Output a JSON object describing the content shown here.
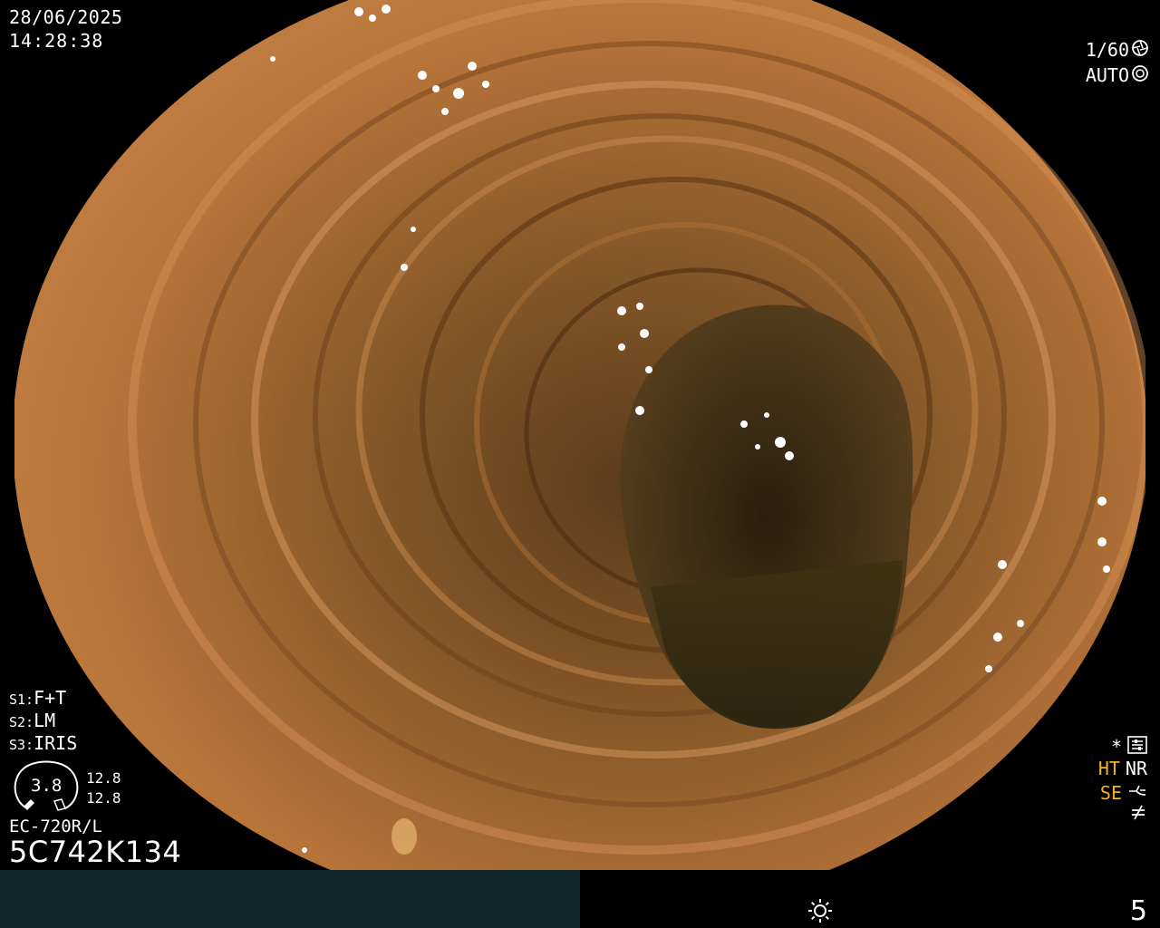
{
  "datetime": {
    "date": "28/06/2025",
    "time": "14:28:38"
  },
  "camera": {
    "shutter": "1/60",
    "shutter_icon": "aperture-icon",
    "iris_mode": "AUTO",
    "iris_icon": "auto-iris-icon"
  },
  "scope_switches": [
    {
      "key": "S1:",
      "value": "F+T"
    },
    {
      "key": "S2:",
      "value": "LM"
    },
    {
      "key": "S3:",
      "value": "IRIS"
    }
  ],
  "gauge": {
    "value": "3.8",
    "reading_1": "12.8",
    "reading_2": "12.8"
  },
  "scope": {
    "model": "EC-720R/L",
    "serial": "5C742K134"
  },
  "indicators": {
    "star": "*",
    "ht": "HT",
    "nr": "NR",
    "se": "SE",
    "settings_icon": "menu-settings-icon",
    "enhance_icon": "enhance-curve-icon",
    "no_freeze_icon": "not-equal-icon"
  },
  "status_bar": {
    "brightness_icon": "brightness-sun-icon",
    "brightness_level": "5"
  },
  "colors": {
    "mucosa": "#b8753a",
    "lumen": "#3a2d14",
    "amber_text": "#f2b21c",
    "status_left_bg": "#11262a"
  }
}
